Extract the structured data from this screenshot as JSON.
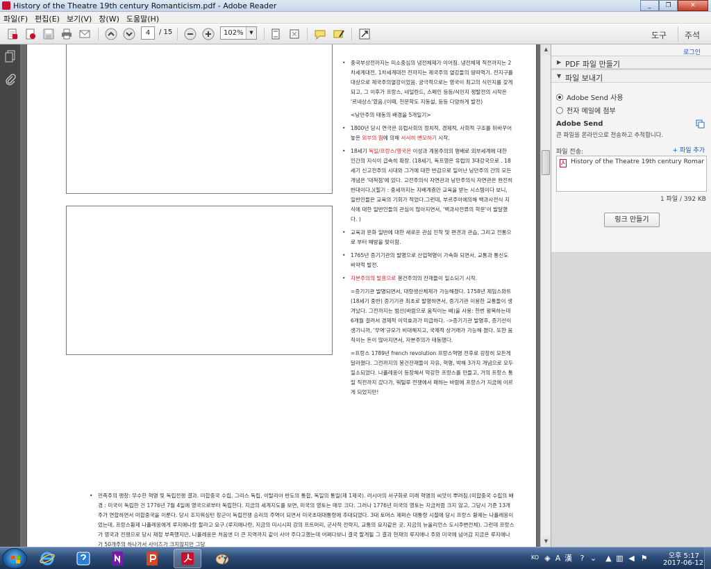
{
  "window": {
    "title": "History of the Theatre  19th century Romanticism.pdf - Adobe Reader",
    "minimize": "_",
    "restore": "❐",
    "close": "✕"
  },
  "menu": [
    "파일(F)",
    "편집(E)",
    "보기(V)",
    "창(W)",
    "도움말(H)"
  ],
  "toolbar": {
    "page_current": "4",
    "page_total": "/ 15",
    "zoom": "102%",
    "tab_tools": "도구",
    "tab_comment": "주석"
  },
  "document": {
    "notes": [
      {
        "type": "bullet",
        "parts": [
          {
            "t": "중국부상전까지는 미소중심의 냉전체제가 이어짐. 냉전체제 직전까지는 2차세계대전, 1차세계대전 전까지는 제국주의 열강들의 땅따먹기. 전지구를 대상으로 제국주의열강이었음. 궁극적으로는 영국이 최고의 식민지를 갖게 되고, 그 이후가 프랑스, 네덜란드, 스페인 등등/식민지 쟁탈전의 시작은 '르네상스'였음.(이때, 천문학도 지동설, 등등 다양하게 발전)"
          }
        ]
      },
      {
        "type": "indent",
        "parts": [
          {
            "t": "<낭만주의 태동의 배경을 5개일기>"
          }
        ]
      },
      {
        "type": "bullet",
        "parts": [
          {
            "t": "1800년 당시 연극은 유럽사회의 정치적, 경제적, 사회적 구조를 뒤바꾸어 놓은 "
          },
          {
            "t": "외부의 힘",
            "red": true
          },
          {
            "t": "에 의해 "
          },
          {
            "t": "서서히 변모하기",
            "red": true
          },
          {
            "t": " 시작."
          }
        ]
      },
      {
        "type": "bullet",
        "parts": [
          {
            "t": "18세기 "
          },
          {
            "t": "독일/프랑스/영국은",
            "red": true
          },
          {
            "t": " 이성과 계몽주의의 명배로 외부세계에 대한 인간의 지식이 급속히 확장. (18세기, 독프영은 유럽의 3대강국으로 . 18세기 신고전주의 시대와 그거에 대한 반감으로 일어난 낭만주의 간의 모든 개념은 '대척점'에 있다. 고전주의식 자연관과 낭만주의식 자연관은 완전히 반대이다.)(필기 : 중세까지는 지배계층만 교육을 받는 시스템이다 보니, 일반인들은 교육의 기회가 적었다.그런데, 부르주아에의해 백과사전식 지식에 대한 일반인들의 관심이 많아지면서, '백과사전류의 학문'이 발달했다. )"
          }
        ]
      },
      {
        "type": "bullet",
        "parts": [
          {
            "t": "교육과 문화 일반에 대한 새로운 관심 진작 및 편견과 관습, 그리고 전통으로 부터 해방을 맞이함."
          }
        ]
      },
      {
        "type": "bullet",
        "parts": [
          {
            "t": "1765년 증기기관의 발명으로 산업혁명이 가속화 되면서, 교통과 통신도 비약적 발전."
          }
        ]
      },
      {
        "type": "bullet",
        "parts": [
          {
            "t": "자본주의의 발흥으로",
            "red": true
          },
          {
            "t": " 봉건주의의 잔재들이 일소되기 시작."
          }
        ]
      },
      {
        "type": "indent",
        "parts": [
          {
            "t": "=증기기관 발명되면서, 대량생산체제가 가능해졌다. 1758년 제임스와트(18세기 중반) 증기기관 최초로 발명하면서, 증기기관 이용한 교통들이 생겨났다. 그전까지는 범선(바람으로 움직이는 배)을 사용: 한번 왕복하는데 6개월 걸려서 경제적 이익효과가 미급하다. ->증기기관 발명후, 증기선이 생기니까, '무역'규모가 비대해지고, 국제적 상거래가 가능해 졌다. 또한 움직이는 돈이 많아지면서, 자본주의가 태동했다."
          }
        ]
      },
      {
        "type": "indent",
        "parts": [
          {
            "t": "=프랑스 1789년 french revolution 프랑스혁명 전후로 굉장히 모든게 달라졌다. 그전까지의 봉건잔재들이 자유, 혁명, 박해 3가지 개념으로 모두 일소되었다. 나폴레옹이 등장해서 막강한 프랑스를 만들고, 거의 프랑스 통일 직전까지 갔다가, 워털루 전쟁에서 패하는 바람에 프랑스가 지금에 이르게 되었지만!"
          }
        ]
      }
    ],
    "bottom_note": "민족주의 팽창: 무수한 혁명 및 독립전쟁 결과. 미합중국 수립, 그리스 독립, 이탈리아 반도의 통합, 독일의 통일(제 1제국). 러시아의 서구화로 미래 혁명의 씨앗이 뿌려짐.(미합중국 수립의 배경 : 미국이 독립한 건 1776년 7월 4일에 영국으로부터 독립한다. 지금의 세계지도를 보면, 미국의 영토는 매우 크다. 그러나 1776년 미국의 영토는 지금처럼 크지 않고, 그당시 기준 13개주가 연합하면서 미합중국을 이룬다. 당시 조지워싱턴 장군이 독립전쟁 승리의 주역이 되면서 미국초대대통령에 추대되었다. 3대 토머스 제퍼슨 대통령 시절에 당시 프랑스 황제는 나폴레옹이었는데, 프랑스황제 나폴레옹에게 루지애나랑 팔라고 요구.(루지애나란, 지금의 미시시피 강의 프트머리, 군사적 전략지, 교통의 요지같은 곳, 지금의 뉴올리언스 도시주변전체). 그런데 프랑스가 영국과 전쟁으로 당시 재정 부족했지만, 나폴레옹은 처음엔 더 큰 지역까지 같이 사야 주다고했는데 어쩌다보니 결국 팔게될 그 결과 현재의 루지애나 주와 미국에 넘어감   지금은 루지애나가 50개주의 하나가서 사이즈가 크지않지만 그당"
  },
  "right_pane": {
    "login": "로그인",
    "sections": {
      "create_pdf": {
        "arrow": "▶",
        "label": "PDF 파일 만들기"
      },
      "send_files": {
        "arrow": "▼",
        "label": "파일 보내기"
      }
    },
    "options": {
      "adobe_send": "Adobe Send 사용",
      "email_attach": "전자 메일에 첨부"
    },
    "adobe_send_title": "Adobe Send",
    "adobe_send_desc": "큰 파일을 온라인으로 전송하고 추적합니다.",
    "send_label": "파일 전송:",
    "add_file": "+ 파일 추가",
    "file_name": "History of the Theatre  19th century Romant...",
    "file_count": "1 파일 / 392 KB",
    "link_button": "링크 만들기"
  },
  "taskbar": {
    "lang": "KO",
    "time": "오후 5:17",
    "date": "2017-06-12"
  },
  "colors": {
    "accent_red": "#d22222",
    "link_blue": "#1a55b6",
    "acrobat_red": "#c8102e"
  }
}
